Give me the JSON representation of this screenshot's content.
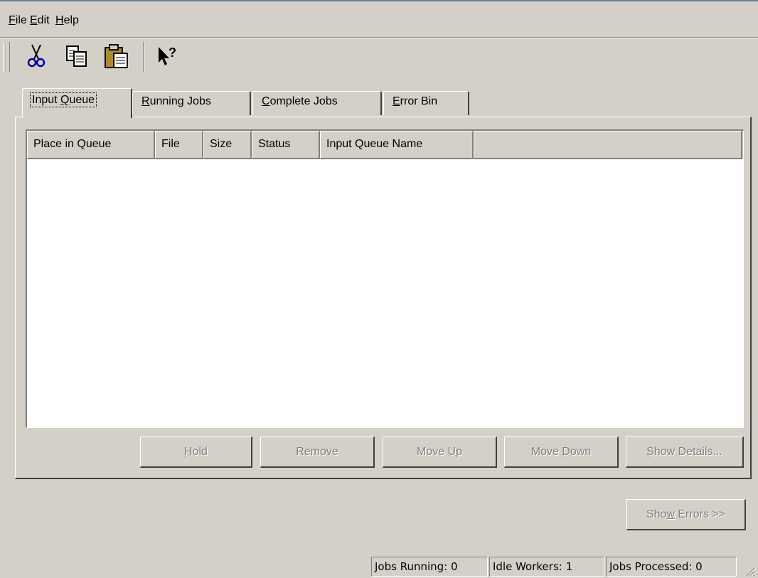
{
  "menu": {
    "file": "File",
    "edit": "Edit",
    "help": "Help"
  },
  "toolbar": {
    "icons": [
      "scissors-icon",
      "copy-icon",
      "clipboard-icon",
      "whats-this-help-icon"
    ]
  },
  "tabs": [
    {
      "label": "Input Queue",
      "mnemonic": "Q",
      "active": true
    },
    {
      "label": "Running Jobs",
      "mnemonic": "R",
      "active": false
    },
    {
      "label": "Complete Jobs",
      "mnemonic": "C",
      "active": false
    },
    {
      "label": "Error Bin",
      "mnemonic": "E",
      "active": false
    }
  ],
  "table": {
    "columns": [
      "Place in Queue",
      "File",
      "Size",
      "Status",
      "Input Queue Name"
    ],
    "rows": []
  },
  "buttons": {
    "hold": "Hold",
    "remove": "Remove",
    "move_up": "Move Up",
    "move_down": "Move Down",
    "show_details": "Show Details...",
    "show_errors": "Show Errors >>"
  },
  "status": {
    "jobs_running": "Jobs Running: 0",
    "idle_workers": "Idle Workers: 1",
    "jobs_processed": "Jobs Processed: 0"
  },
  "colors": {
    "window_bg": "#d4d0c8",
    "disabled_text": "#808080"
  }
}
